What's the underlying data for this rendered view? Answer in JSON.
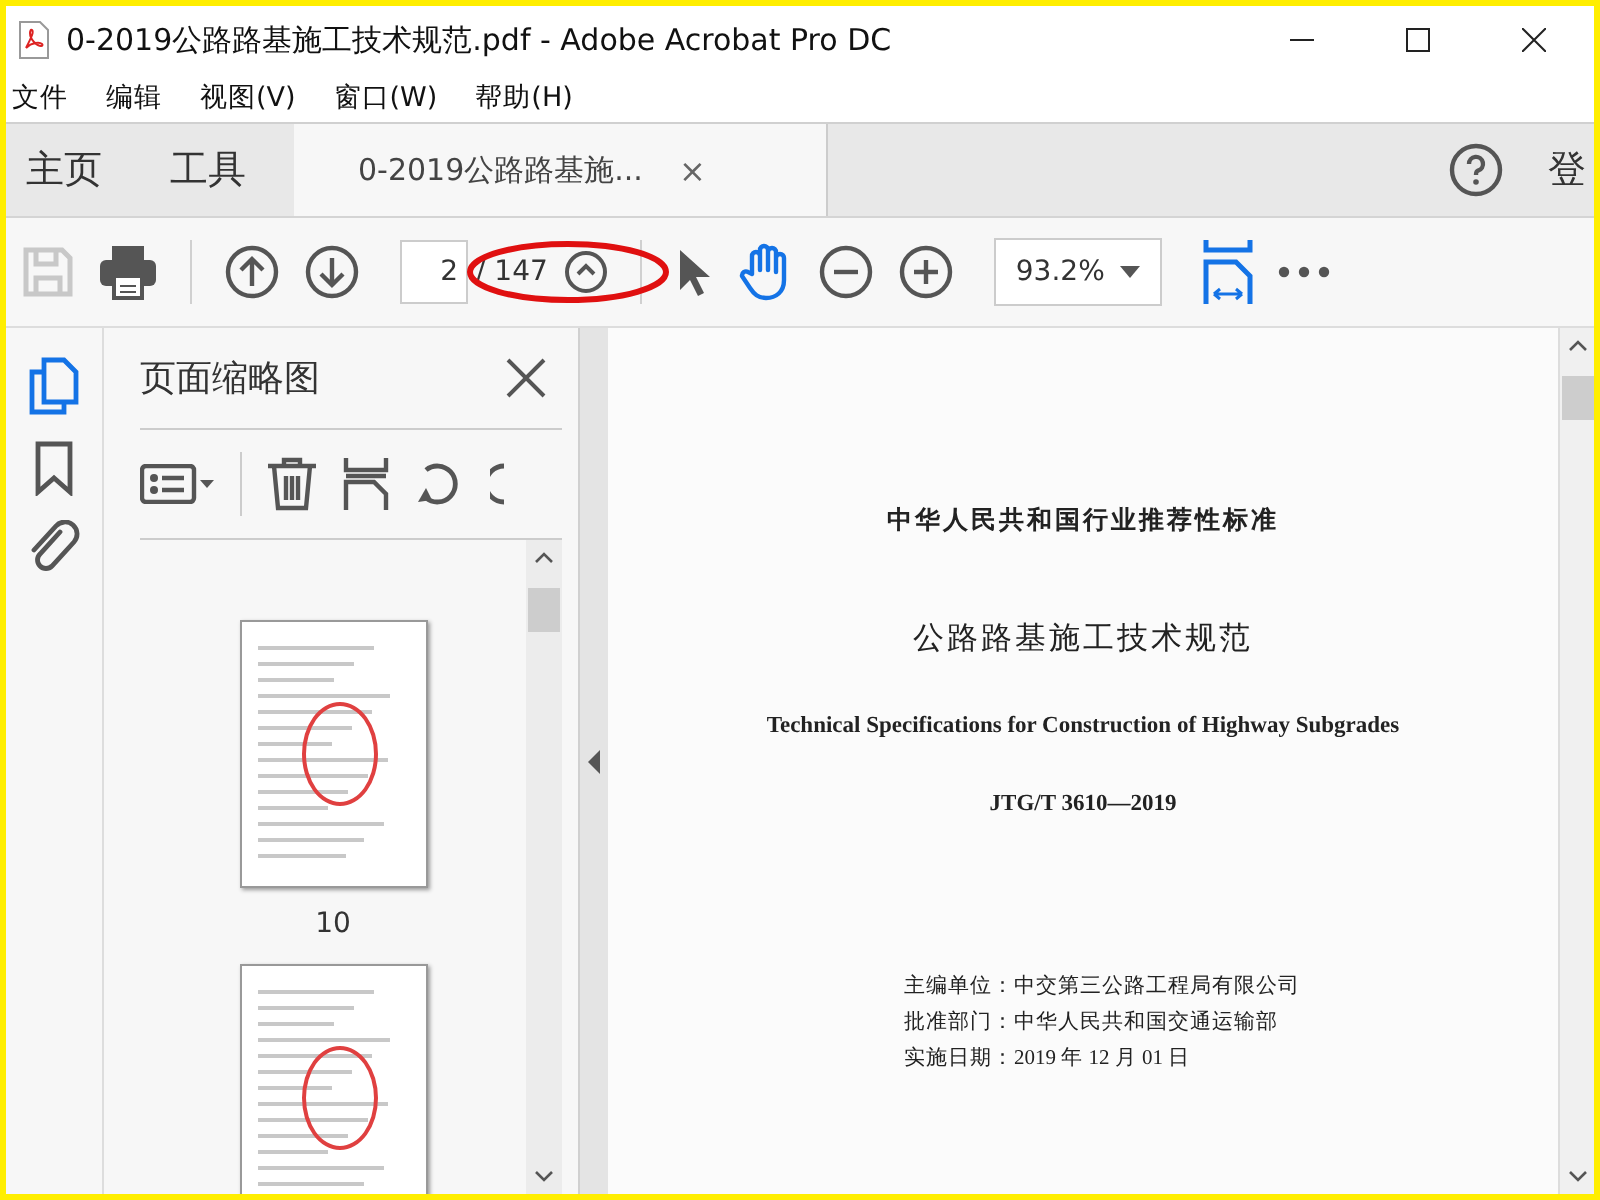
{
  "window": {
    "title": "0-2019公路路基施工技术规范.pdf - Adobe Acrobat Pro DC"
  },
  "menu": [
    "文件",
    "编辑",
    "视图(V)",
    "窗口(W)",
    "帮助(H)"
  ],
  "nav_tabs": [
    {
      "label": "主页",
      "selected": false
    },
    {
      "label": "工具",
      "selected": false
    }
  ],
  "doc_tab": {
    "label": "0-2019公路路基施...",
    "selected": true,
    "close": "×"
  },
  "account": {
    "label": "登"
  },
  "toolbar": {
    "page_value": "2",
    "page_total": "/ 147",
    "zoom": "93.2%",
    "hand_active": true,
    "save_disabled": true,
    "annotation_circle": true
  },
  "rail": [
    {
      "kind": "pages",
      "selected": true
    },
    {
      "kind": "bookmarks",
      "selected": false
    },
    {
      "kind": "attachments",
      "selected": false
    }
  ],
  "sidebar": {
    "title": "页面缩略图"
  },
  "thumbnails": [
    {
      "label": "10",
      "stamp": true
    },
    {
      "stamp": true
    }
  ],
  "document": {
    "lines": [
      {
        "kind": "subtitle",
        "text": "中华人民共和国行业推荐性标准"
      },
      {
        "kind": "title",
        "text": "公路路基施工技术规范"
      },
      {
        "kind": "english",
        "text": "Technical Specifications for Construction of Highway Subgrades"
      },
      {
        "kind": "code",
        "text": "JTG/T 3610—2019"
      },
      {
        "kind": "info",
        "text": "主编单位：中交第三公路工程局有限公司"
      },
      {
        "kind": "info",
        "text": "批准部门：中华人民共和国交通运输部"
      },
      {
        "kind": "info",
        "text": "实施日期：2019 年 12 月 01 日"
      }
    ]
  }
}
